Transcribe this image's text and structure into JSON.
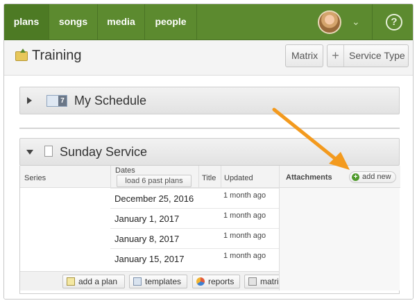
{
  "nav": {
    "items": [
      {
        "label": "plans",
        "active": true
      },
      {
        "label": "songs"
      },
      {
        "label": "media"
      },
      {
        "label": "people"
      }
    ],
    "chevron": "⌄",
    "help": "?"
  },
  "page": {
    "title": "Training",
    "buttons": {
      "matrix": "Matrix",
      "service_type": "Service Type",
      "service_type_icon": "+"
    }
  },
  "sections": {
    "schedule": {
      "title": "My Schedule",
      "calendar_num": "7"
    },
    "sunday": {
      "title": "Sunday Service"
    }
  },
  "table": {
    "headers": {
      "series": "Series",
      "dates": "Dates",
      "title": "Title",
      "updated": "Updated"
    },
    "load_past": "load 6 past plans",
    "rows": [
      {
        "date": "December 25, 2016",
        "updated": "1 month ago"
      },
      {
        "date": "January 1, 2017",
        "updated": "1 month ago"
      },
      {
        "date": "January 8, 2017",
        "updated": "1 month ago"
      },
      {
        "date": "January 15, 2017",
        "updated": "1 month ago"
      }
    ]
  },
  "attachments": {
    "label": "Attachments",
    "add_new": "add new",
    "add_icon": "+"
  },
  "toolbar": {
    "add_plan": "add a plan",
    "templates": "templates",
    "reports": "reports",
    "matrix": "matri"
  },
  "colors": {
    "nav_green": "#5c8a2f",
    "annotation_arrow": "#f39a1e"
  }
}
